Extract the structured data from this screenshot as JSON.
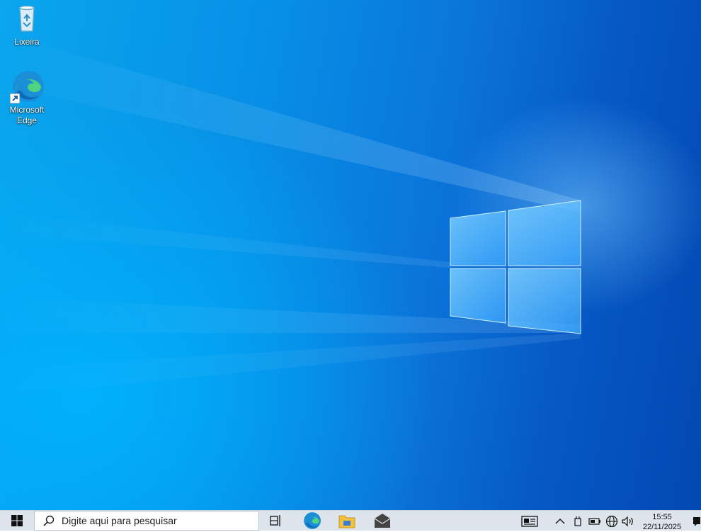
{
  "desktop": {
    "icons": [
      {
        "label": "Lixeira",
        "icon": "recycle-bin-icon"
      },
      {
        "label_line1": "Microsoft",
        "label_line2": "Edge",
        "icon": "edge-icon"
      }
    ]
  },
  "taskbar": {
    "start_icon": "windows-logo-icon",
    "search": {
      "placeholder": "Digite aqui para pesquisar",
      "icon": "search-icon"
    },
    "apps": [
      {
        "name": "Task View",
        "icon": "task-view-icon"
      },
      {
        "name": "Microsoft Edge",
        "icon": "edge-icon"
      },
      {
        "name": "File Explorer",
        "icon": "folder-icon"
      },
      {
        "name": "Mail",
        "icon": "mail-icon"
      }
    ],
    "tray": {
      "icons": [
        "news-widget-icon",
        "chevron-up-icon",
        "battery-plug-icon",
        "battery-icon",
        "network-globe-icon",
        "volume-icon"
      ],
      "time": "15:55",
      "date": "22/11/2025"
    }
  },
  "colors": {
    "taskbar_bg": "#dde4ec",
    "desktop_accent": "#0a74da"
  }
}
